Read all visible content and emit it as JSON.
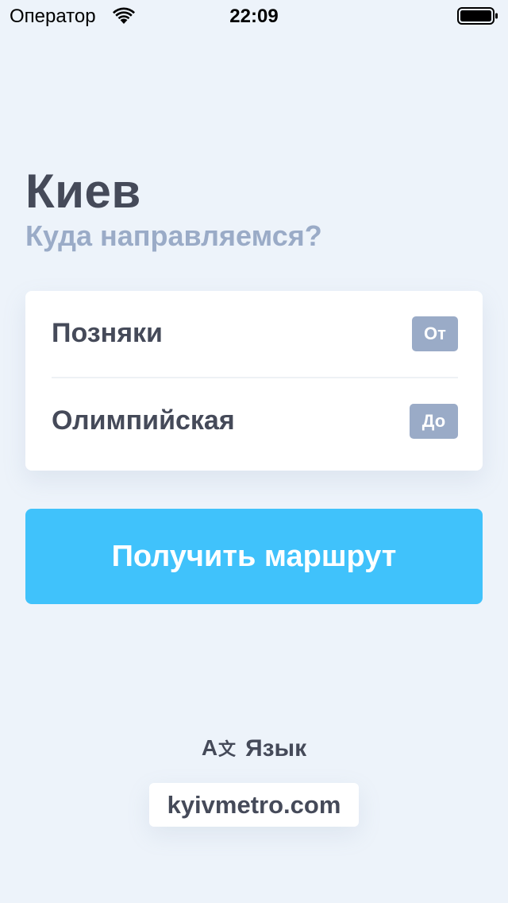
{
  "status_bar": {
    "carrier": "Оператор",
    "time": "22:09",
    "wifi_icon": "wifi-icon",
    "battery_icon": "battery-icon"
  },
  "header": {
    "city": "Киев",
    "subtitle": "Куда направляемся?"
  },
  "route": {
    "from": {
      "station": "Позняки",
      "badge": "От"
    },
    "to": {
      "station": "Олимпийская",
      "badge": "До"
    }
  },
  "actions": {
    "get_route_label": "Получить маршрут"
  },
  "footer": {
    "language_icon": "translate-icon",
    "language_label": "Язык",
    "website": "kyivmetro.com"
  },
  "colors": {
    "background": "#edf3fa",
    "text_primary": "#454a59",
    "text_secondary": "#9aabc7",
    "accent": "#40c2fb",
    "badge": "#9aabc7"
  }
}
